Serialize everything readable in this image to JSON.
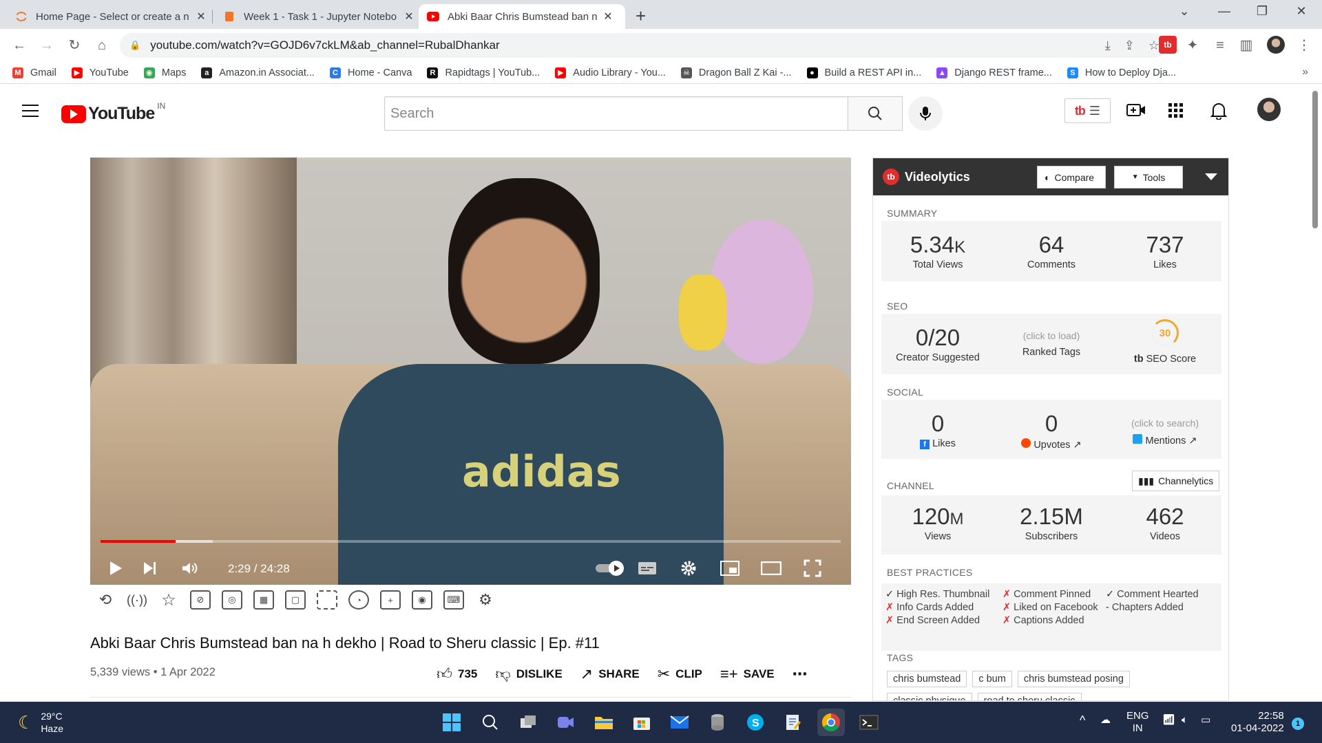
{
  "browser": {
    "tabs": [
      {
        "title": "Home Page - Select or create a n",
        "close": "✕"
      },
      {
        "title": "Week 1 - Task 1 - Jupyter Notebo",
        "close": "✕"
      },
      {
        "title": "Abki Baar Chris Bumstead ban na",
        "close": "✕"
      }
    ],
    "new_tab": "+",
    "url": "youtube.com/watch?v=GOJD6v7ckLM&ab_channel=RubalDhankar",
    "bookmarks": [
      {
        "label": "Gmail",
        "icon": "gmail-icon",
        "color": "#ea4335",
        "glyph": "M"
      },
      {
        "label": "YouTube",
        "icon": "youtube-icon",
        "color": "#ff0000",
        "glyph": "▶"
      },
      {
        "label": "Maps",
        "icon": "maps-icon",
        "color": "#34a853",
        "glyph": "◉"
      },
      {
        "label": "Amazon.in Associat...",
        "icon": "amazon-icon",
        "color": "#222222",
        "glyph": "a"
      },
      {
        "label": "Home - Canva",
        "icon": "canva-icon",
        "color": "#2d7be4",
        "glyph": "C"
      },
      {
        "label": "Rapidtags | YouTub...",
        "icon": "rapidtags-icon",
        "color": "#111111",
        "glyph": "R"
      },
      {
        "label": "Audio Library - You...",
        "icon": "youtube-icon",
        "color": "#ff0000",
        "glyph": "▶"
      },
      {
        "label": "Dragon Ball Z Kai -...",
        "icon": "onepiece-icon",
        "color": "#555555",
        "glyph": "☠"
      },
      {
        "label": "Build a REST API in...",
        "icon": "medium-icon",
        "color": "#000000",
        "glyph": "●"
      },
      {
        "label": "Django REST frame...",
        "icon": "django-icon",
        "color": "#8a4af3",
        "glyph": "▲"
      },
      {
        "label": "How to Deploy Dja...",
        "icon": "s-icon",
        "color": "#1a8cff",
        "glyph": "S"
      }
    ],
    "bookmarks_more": "»"
  },
  "youtube": {
    "logo_text": "YouTube",
    "country_code": "IN",
    "search_placeholder": "Search",
    "title": "Abki Baar Chris Bumstead ban na h dekho | Road to Sheru classic | Ep. #11",
    "meta": "5,339 views • 1 Apr 2022",
    "actions": {
      "like_count": "735",
      "dislike": "DISLIKE",
      "share": "SHARE",
      "clip": "CLIP",
      "save": "SAVE"
    },
    "player": {
      "time": "2:29 / 24:28",
      "played_fraction": 0.101,
      "buffered_fraction": 0.152,
      "shirt_text": "adidas"
    }
  },
  "videolytics": {
    "title": "Videolytics",
    "compare": "Compare",
    "tools": "Tools",
    "summary_label": "SUMMARY",
    "summary": {
      "views": "5.34",
      "views_unit": "K",
      "views_label": "Total Views",
      "comments": "64",
      "comments_label": "Comments",
      "likes": "737",
      "likes_label": "Likes"
    },
    "seo_label": "SEO",
    "seo": {
      "suggested": "0/20",
      "suggested_label": "Creator Suggested",
      "ranked_hint": "(click to load)",
      "ranked_label": "Ranked Tags",
      "score": "30",
      "score_label": "SEO Score"
    },
    "social_label": "SOCIAL",
    "social": {
      "fb_value": "0",
      "fb_label": "Likes",
      "reddit_value": "0",
      "reddit_label": "Upvotes",
      "twitter_hint": "(click to search)",
      "twitter_label": "Mentions"
    },
    "channel_label": "CHANNEL",
    "channelytics": "Channelytics",
    "channel": {
      "views": "120",
      "views_unit": "M",
      "views_label": "Views",
      "subs": "2.15M",
      "subs_label": "Subscribers",
      "videos": "462",
      "videos_label": "Videos"
    },
    "best_label": "BEST PRACTICES",
    "best": [
      {
        "mark": "✓",
        "ok": true,
        "text": "High Res. Thumbnail"
      },
      {
        "mark": "✗",
        "ok": false,
        "text": "Comment Pinned"
      },
      {
        "mark": "✓",
        "ok": true,
        "text": "Comment Hearted"
      },
      {
        "mark": "✗",
        "ok": false,
        "text": "Info Cards Added"
      },
      {
        "mark": "✗",
        "ok": false,
        "text": "Liked on Facebook"
      },
      {
        "mark": "-",
        "ok": true,
        "text": "Chapters Added"
      },
      {
        "mark": "✗",
        "ok": false,
        "text": "End Screen Added"
      },
      {
        "mark": "✗",
        "ok": false,
        "text": "Captions Added"
      }
    ],
    "tags_label": "TAGS",
    "tags": [
      "chris bumstead",
      "c bum",
      "chris bumstead posing",
      "classic physique",
      "road to sheru classic"
    ]
  },
  "taskbar": {
    "temp": "29°C",
    "weather": "Haze",
    "lang1": "ENG",
    "lang2": "IN",
    "time": "22:58",
    "date": "01-04-2022",
    "notifications": "1"
  }
}
